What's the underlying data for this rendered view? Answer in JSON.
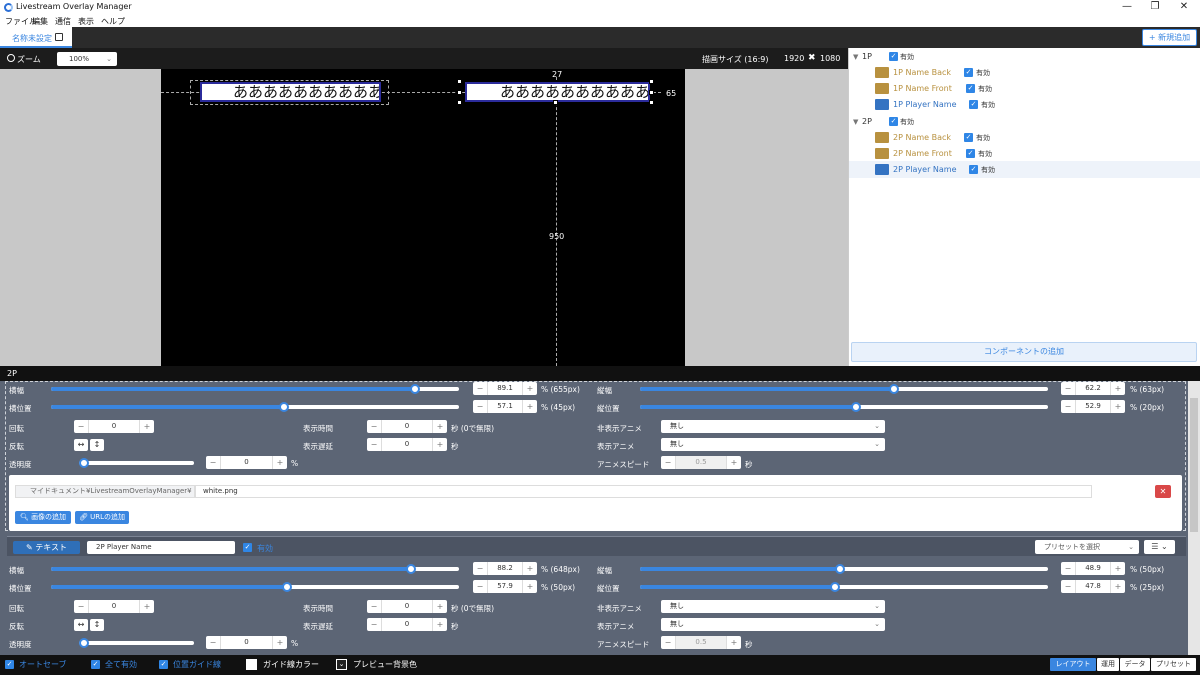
{
  "app": {
    "title": "Livestream Overlay Manager"
  },
  "window": {
    "minimize": "—",
    "maximize": "❐",
    "close": "✕"
  },
  "menu": [
    "ファイル",
    "編集",
    "通信",
    "表示",
    "ヘルプ"
  ],
  "tab": {
    "label": "名称未設定"
  },
  "header": {
    "add_new": "+ 新規追加"
  },
  "toolbar": {
    "zoom_label": "ズーム",
    "zoom_value": "100%",
    "size_label": "描画サイズ (16:9)",
    "width": "1920",
    "x": "✖",
    "height": "1080"
  },
  "preview": {
    "box1_text": "ああああああああああああ",
    "box2_text": "ああああああああああああ",
    "measure_top": "27",
    "measure_right": "65",
    "measure_bottom": "950"
  },
  "tree": {
    "groups": [
      {
        "name": "1P",
        "enabled_label": "有効",
        "items": [
          {
            "name": "1P Name Back",
            "type": "image",
            "enabled_label": "有効"
          },
          {
            "name": "1P Name Front",
            "type": "image",
            "enabled_label": "有効"
          },
          {
            "name": "1P Player Name",
            "type": "text",
            "enabled_label": "有効"
          }
        ]
      },
      {
        "name": "2P",
        "enabled_label": "有効",
        "items": [
          {
            "name": "2P Name Back",
            "type": "image",
            "enabled_label": "有効"
          },
          {
            "name": "2P Name Front",
            "type": "image",
            "enabled_label": "有効"
          },
          {
            "name": "2P Player Name",
            "type": "text",
            "enabled_label": "有効"
          }
        ]
      }
    ],
    "add_component": "コンポーネントの追加"
  },
  "props": {
    "title": "2P",
    "labels": {
      "width": "横幅",
      "height": "縦幅",
      "xpos": "横位置",
      "ypos": "縦位置",
      "rotate": "回転",
      "flip": "反転",
      "opacity": "透明度",
      "show_time": "表示時間",
      "show_delay": "表示遅延",
      "hide_anim": "非表示アニメ",
      "show_anim": "表示アニメ",
      "anim_speed": "アニメスピード"
    },
    "units": {
      "sec_inf": "秒 (0で無限)",
      "sec": "秒",
      "pct": "%"
    },
    "image": {
      "width_pct": 89.1,
      "width_val": "89.1",
      "width_unit": "% (655px)",
      "height_pct": 62.2,
      "height_val": "62.2",
      "height_unit": "% (63px)",
      "xpos_pct": 57.1,
      "xpos_val": "57.1",
      "xpos_unit": "% (45px)",
      "ypos_pct": 52.9,
      "ypos_val": "52.9",
      "ypos_unit": "% (20px)",
      "rotate": "0",
      "opacity": "0",
      "show_time": "0",
      "show_delay": "0",
      "hide_anim": "無し",
      "show_anim": "無し",
      "anim_speed": "0.5",
      "path": "マイドキュメント¥LivestreamOverlayManager¥",
      "file": "white.png",
      "add_image": "画像の追加",
      "add_url": "URLの追加",
      "remove": "✕"
    },
    "text": {
      "type_label": "テキスト",
      "name": "2P Player Name",
      "enabled_label": "有効",
      "preset_placeholder": "プリセットを選択",
      "menu": "☰ ⌄",
      "width_pct": 88.2,
      "width_val": "88.2",
      "width_unit": "% (648px)",
      "height_pct": 48.9,
      "height_val": "48.9",
      "height_unit": "% (50px)",
      "xpos_pct": 57.9,
      "xpos_val": "57.9",
      "xpos_unit": "% (50px)",
      "ypos_pct": 47.8,
      "ypos_val": "47.8",
      "ypos_unit": "% (25px)",
      "rotate": "0",
      "opacity": "0",
      "show_time": "0",
      "show_delay": "0",
      "hide_anim": "無し",
      "show_anim": "無し",
      "anim_speed": "0.5"
    }
  },
  "status": {
    "autosave": "オートセーブ",
    "all_enabled": "全て有効",
    "position_guides": "位置ガイド線",
    "guide_color": "ガイド線カラー",
    "preview_bg": "プレビュー背景色",
    "modes": [
      "レイアウト",
      "運用",
      "データ",
      "プリセット"
    ]
  },
  "colors": {
    "accent": "#3a86e0",
    "image_item": "#b8913f",
    "text_item": "#3473c2",
    "panel_bg": "#5c6575"
  }
}
